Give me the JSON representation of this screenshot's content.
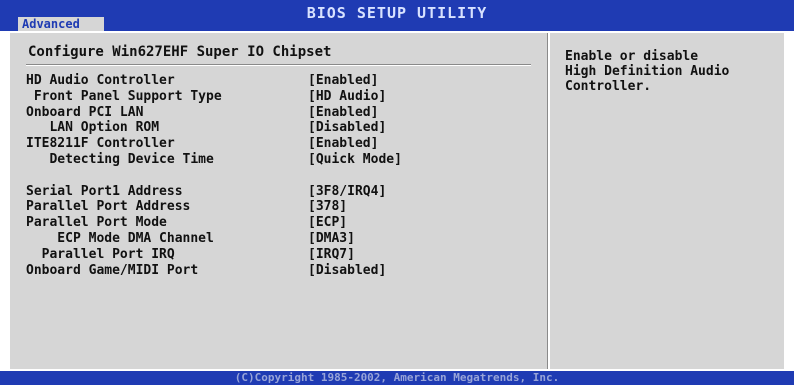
{
  "header": {
    "title": "BIOS SETUP UTILITY",
    "active_tab": "Advanced"
  },
  "section_title": "Configure Win627EHF Super IO Chipset",
  "items": [
    {
      "label": "HD Audio Controller",
      "value": "[Enabled]"
    },
    {
      "label": " Front Panel Support Type",
      "value": "[HD Audio]"
    },
    {
      "label": "Onboard PCI LAN",
      "value": "[Enabled]"
    },
    {
      "label": "   LAN Option ROM",
      "value": "[Disabled]"
    },
    {
      "label": "ITE8211F Controller",
      "value": "[Enabled]"
    },
    {
      "label": "   Detecting Device Time",
      "value": "[Quick Mode]"
    },
    {
      "label": "Serial Port1 Address",
      "value": "[3F8/IRQ4]"
    },
    {
      "label": "Parallel Port Address",
      "value": "[378]"
    },
    {
      "label": "Parallel Port Mode",
      "value": "[ECP]"
    },
    {
      "label": "    ECP Mode DMA Channel",
      "value": "[DMA3]"
    },
    {
      "label": "  Parallel Port IRQ",
      "value": "[IRQ7]"
    },
    {
      "label": "Onboard Game/MIDI Port",
      "value": "[Disabled]"
    }
  ],
  "help": {
    "lines": [
      "Enable or disable",
      "High Definition Audio",
      "Controller."
    ]
  },
  "footer": {
    "copyright": "(C)Copyright 1985-2002, American Megatrends, Inc."
  },
  "colors": {
    "bar_blue": "#1f3bb3",
    "panel_gray": "#d6d6d6"
  }
}
